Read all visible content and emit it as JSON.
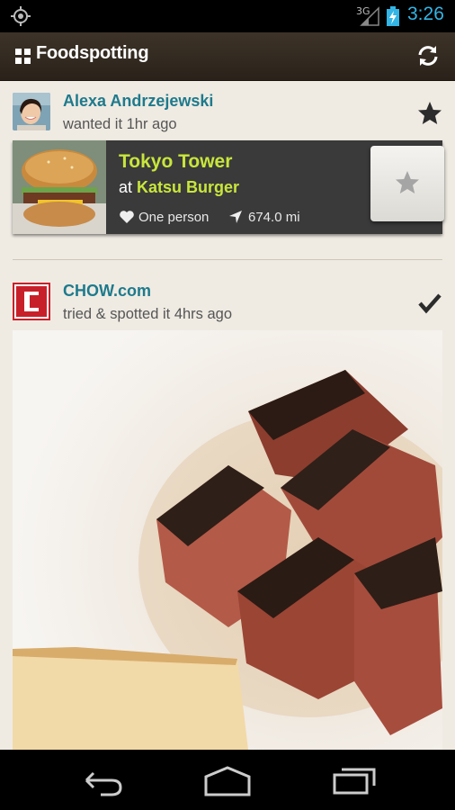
{
  "status_bar": {
    "network_type": "3G",
    "time": "3:26",
    "accent_color": "#33b5e5",
    "icons": [
      "gps-icon",
      "signal-icon",
      "battery-charging-icon"
    ]
  },
  "action_bar": {
    "title": "Foodspotting",
    "icons": [
      "app-grid-icon",
      "refresh-icon"
    ]
  },
  "feed": [
    {
      "username": "Alexa Andrzejewski",
      "action": "wanted it 1hr ago",
      "status_icon": "star-icon",
      "card": {
        "dish": "Tokyo Tower",
        "at_prefix": "at",
        "place": "Katsu Burger",
        "likes": "One person",
        "distance": "674.0 mi"
      }
    },
    {
      "username": "CHOW.com",
      "action": "tried & spotted it 4hrs ago",
      "status_icon": "checkmark-icon",
      "logo_letter": "C"
    }
  ],
  "colors": {
    "username": "#1e7a8c",
    "dish_highlight": "#c8e63c",
    "chow_red": "#c8202a"
  },
  "nav_bar": {
    "icons": [
      "back-icon",
      "home-icon",
      "recent-apps-icon"
    ]
  }
}
